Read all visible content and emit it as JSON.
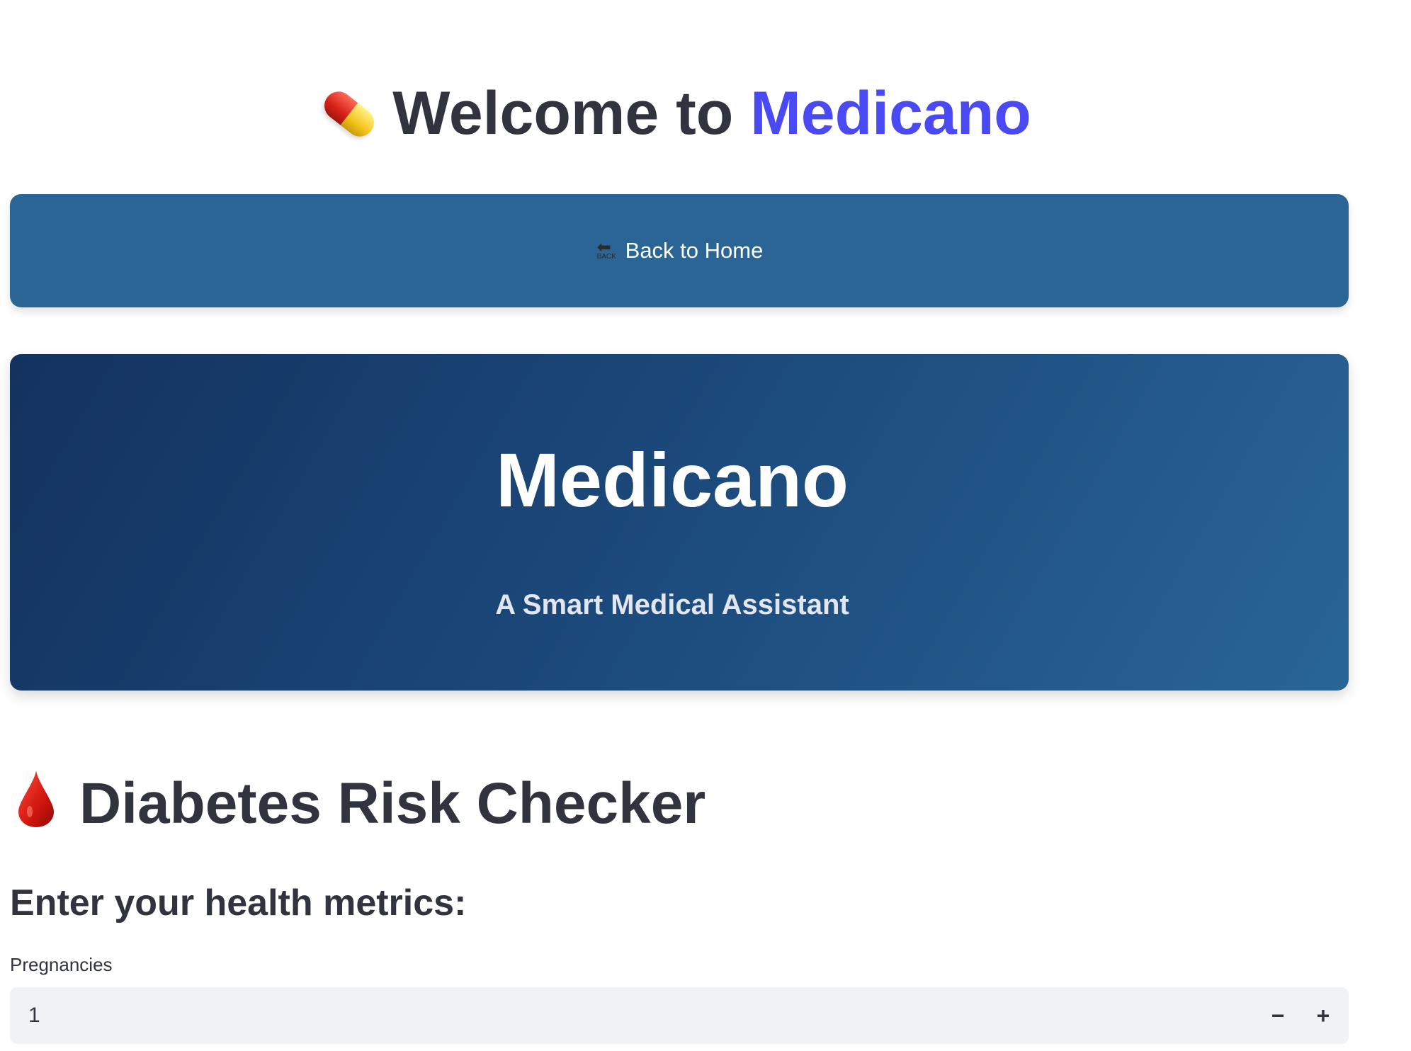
{
  "header": {
    "welcome_prefix": "Welcome to ",
    "brand": "Medicano",
    "icon": "pill-icon",
    "brand_color": "#4a4af4"
  },
  "back_button": {
    "label": "Back to Home",
    "icon": "back-arrow-icon",
    "icon_text": "BACK",
    "color": "#2a6595"
  },
  "hero": {
    "title": "Medicano",
    "subtitle": "A Smart Medical Assistant"
  },
  "checker": {
    "title": "Diabetes Risk Checker",
    "icon": "blood-drop-icon",
    "subheading": "Enter your health metrics:",
    "fields": [
      {
        "label": "Pregnancies",
        "value": "1",
        "decrement": "−",
        "increment": "+"
      }
    ]
  }
}
